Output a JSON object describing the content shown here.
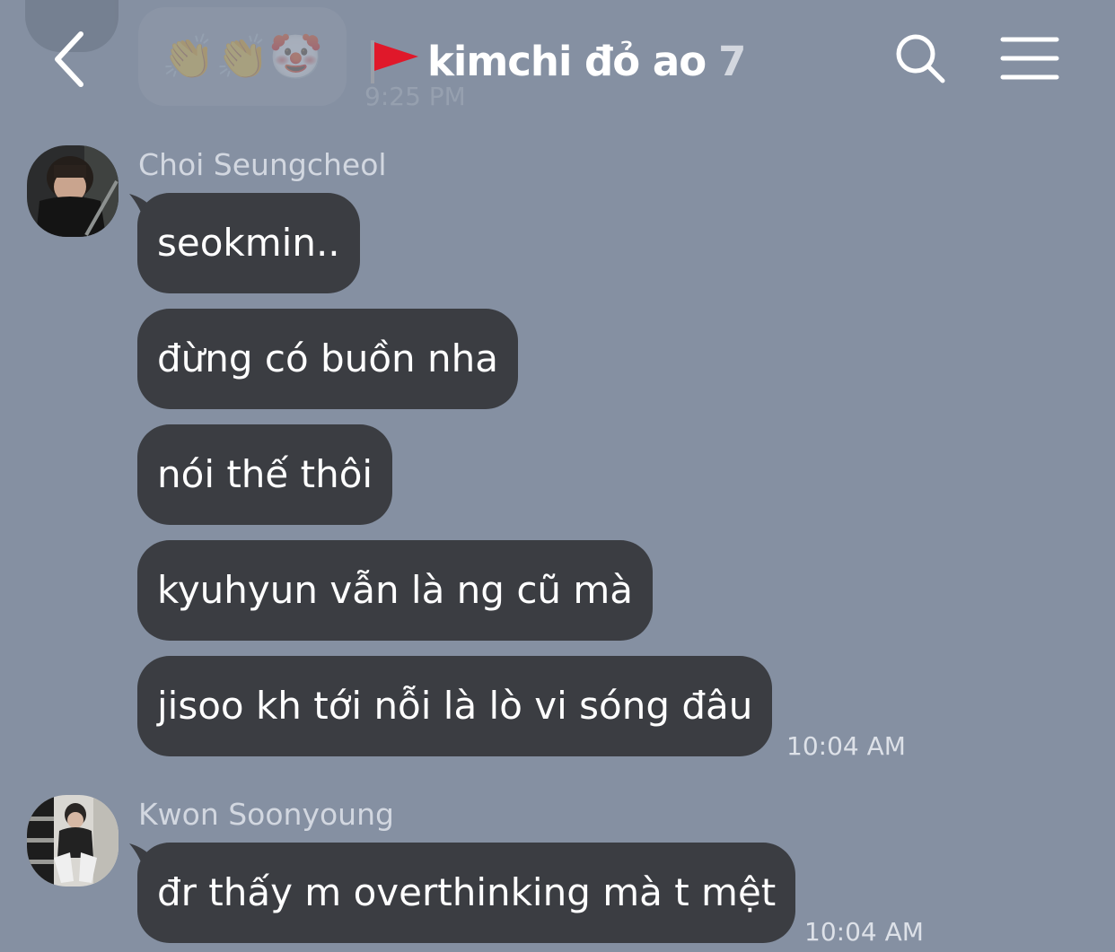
{
  "previous_message": {
    "emojis": "👏👏🤡",
    "time": "9:25 PM"
  },
  "header": {
    "title": "kimchi đỏ ao",
    "member_count": "7"
  },
  "messages": [
    {
      "sender": "Choi Seungcheol",
      "bubbles": [
        "seokmin..",
        "đừng có buồn nha",
        "nói thế thôi",
        "kyuhyun vẫn là ng cũ mà",
        "jisoo kh tới nỗi là lò vi sóng đâu"
      ],
      "time": "10:04 AM"
    },
    {
      "sender": "Kwon Soonyoung",
      "bubbles": [
        "đr thấy m overthinking mà t mệt"
      ],
      "time": "10:04 AM"
    }
  ],
  "colors": {
    "background": "#8590a2",
    "bubble": "#3b3d42",
    "bubble_text": "#ffffff",
    "sender_name": "#d2d7e0",
    "timestamp": "#dde1e8",
    "flag_red": "#e0182a"
  }
}
